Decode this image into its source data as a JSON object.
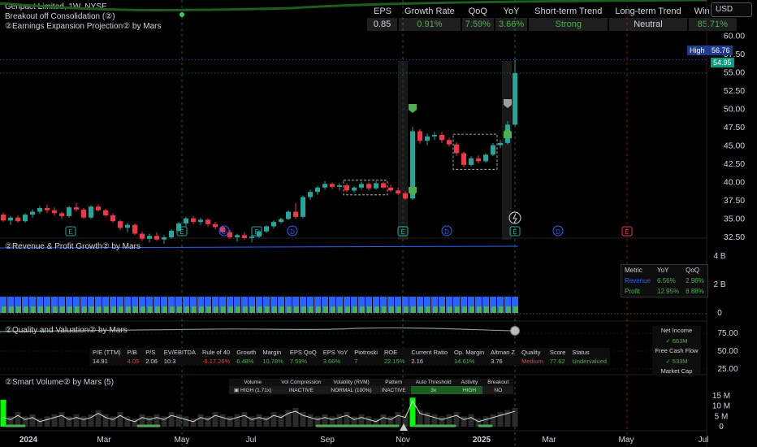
{
  "header": {
    "title": "Genpact Limited, 1W, NYSE",
    "indicator_1": "Breakout off Consolidation (②)",
    "indicator_2": "②Earnings Expansion Projection② by Mars",
    "currency_button": "USD"
  },
  "stats_table": {
    "headers": [
      "EPS",
      "Growth Rate",
      "QoQ",
      "YoY",
      "Short-term Trend",
      "Long-term Trend",
      "Win Rate"
    ],
    "values": [
      "0.85",
      "0.91%",
      "7.59%",
      "3.66%",
      "Strong",
      "Neutral",
      "85.71%"
    ]
  },
  "price_tags": {
    "high_label": "High",
    "high_value": "56.76",
    "last_value": "54.95"
  },
  "chart_data": [
    {
      "type": "candlestick",
      "title": "Genpact Limited, 1W, NYSE",
      "y_ticks": [
        "60.00",
        "57.50",
        "55.00",
        "52.50",
        "50.00",
        "47.50",
        "45.00",
        "42.50",
        "40.00",
        "37.50",
        "35.00",
        "32.50"
      ],
      "ylim": [
        31.5,
        61.5
      ],
      "x_ticks": [
        "2024",
        "Mar",
        "May",
        "Jul",
        "Sep",
        "Nov",
        "2025",
        "Mar",
        "May",
        "Jul"
      ],
      "high": 56.76,
      "last": 54.95,
      "candles": [
        [
          35.6,
          35.9,
          34.6,
          34.8
        ],
        [
          34.8,
          35.4,
          34.2,
          35.2
        ],
        [
          35.2,
          35.5,
          34.5,
          34.7
        ],
        [
          34.7,
          35.8,
          34.5,
          35.6
        ],
        [
          35.6,
          36.3,
          35.2,
          36.0
        ],
        [
          36.0,
          36.8,
          35.7,
          36.5
        ],
        [
          36.5,
          37.0,
          35.8,
          36.2
        ],
        [
          36.2,
          36.6,
          35.5,
          35.8
        ],
        [
          35.8,
          36.0,
          35.0,
          35.4
        ],
        [
          35.4,
          36.8,
          35.2,
          36.6
        ],
        [
          36.6,
          37.2,
          36.0,
          36.3
        ],
        [
          36.3,
          36.5,
          35.0,
          35.2
        ],
        [
          35.2,
          36.9,
          35.0,
          36.7
        ],
        [
          36.7,
          37.0,
          36.0,
          36.2
        ],
        [
          36.2,
          36.4,
          35.3,
          35.5
        ],
        [
          35.5,
          35.8,
          34.5,
          34.7
        ],
        [
          34.7,
          34.9,
          33.5,
          33.8
        ],
        [
          33.8,
          34.5,
          33.2,
          34.2
        ],
        [
          34.2,
          34.4,
          32.8,
          33.0
        ],
        [
          33.0,
          33.3,
          32.0,
          32.3
        ],
        [
          32.3,
          33.0,
          31.8,
          32.7
        ],
        [
          32.7,
          33.2,
          32.0,
          32.2
        ],
        [
          32.2,
          32.8,
          31.6,
          32.5
        ],
        [
          32.5,
          33.6,
          32.3,
          33.4
        ],
        [
          33.4,
          34.6,
          33.2,
          34.4
        ],
        [
          34.4,
          35.3,
          34.0,
          35.1
        ],
        [
          35.1,
          35.4,
          34.3,
          34.6
        ],
        [
          34.6,
          35.2,
          34.2,
          34.9
        ],
        [
          34.9,
          35.1,
          34.0,
          34.3
        ],
        [
          34.3,
          34.6,
          33.6,
          33.9
        ],
        [
          33.9,
          34.1,
          33.0,
          33.2
        ],
        [
          33.2,
          33.5,
          32.3,
          32.5
        ],
        [
          32.5,
          33.0,
          31.9,
          32.8
        ],
        [
          32.8,
          33.2,
          32.2,
          32.4
        ],
        [
          32.4,
          32.9,
          31.8,
          32.6
        ],
        [
          32.6,
          33.5,
          32.4,
          33.3
        ],
        [
          33.3,
          34.2,
          33.1,
          34.0
        ],
        [
          34.0,
          34.8,
          33.7,
          34.6
        ],
        [
          34.6,
          35.2,
          34.4,
          35.0
        ],
        [
          35.0,
          36.2,
          34.9,
          36.0
        ],
        [
          36.0,
          37.2,
          35.0,
          35.3
        ],
        [
          35.3,
          38.2,
          35.1,
          38.0
        ],
        [
          38.0,
          39.0,
          37.6,
          38.7
        ],
        [
          38.7,
          39.5,
          38.3,
          39.3
        ],
        [
          39.3,
          40.2,
          39.0,
          39.8
        ],
        [
          39.8,
          40.0,
          39.1,
          39.4
        ],
        [
          39.4,
          39.9,
          38.9,
          39.6
        ],
        [
          39.6,
          39.9,
          38.7,
          38.9
        ],
        [
          38.9,
          39.5,
          38.6,
          39.3
        ],
        [
          39.3,
          40.1,
          39.0,
          39.8
        ],
        [
          39.8,
          40.0,
          38.9,
          39.2
        ],
        [
          39.2,
          40.2,
          39.0,
          39.9
        ],
        [
          39.9,
          40.1,
          39.1,
          39.3
        ],
        [
          39.3,
          39.7,
          38.7,
          38.9
        ],
        [
          38.9,
          39.3,
          38.3,
          38.5
        ],
        [
          38.5,
          38.8,
          37.6,
          37.8
        ],
        [
          37.8,
          47.6,
          37.6,
          47.0
        ],
        [
          47.0,
          47.3,
          45.3,
          45.7
        ],
        [
          45.7,
          46.7,
          45.1,
          46.3
        ],
        [
          46.3,
          46.9,
          45.8,
          46.5
        ],
        [
          46.5,
          46.9,
          45.4,
          45.8
        ],
        [
          45.8,
          46.1,
          44.9,
          45.2
        ],
        [
          45.2,
          45.5,
          43.6,
          44.0
        ],
        [
          44.0,
          44.2,
          42.1,
          42.4
        ],
        [
          42.4,
          43.6,
          42.2,
          43.3
        ],
        [
          43.3,
          43.7,
          42.6,
          42.9
        ],
        [
          42.9,
          44.0,
          42.7,
          43.8
        ],
        [
          43.8,
          45.4,
          43.6,
          45.1
        ],
        [
          45.1,
          45.8,
          44.7,
          45.4
        ],
        [
          45.4,
          48.4,
          45.2,
          47.9
        ],
        [
          47.9,
          56.76,
          47.7,
          54.95
        ]
      ],
      "earnings_markers": [
        "E",
        "E",
        "D",
        "E",
        "D",
        "E",
        "D",
        "E",
        "D",
        "E"
      ]
    },
    {
      "type": "bar",
      "title": "②Revenue & Profit Growth② by Mars",
      "y_ticks": [
        "4 B",
        "2 B",
        "0"
      ],
      "table": {
        "headers": [
          "Metric",
          "YoY",
          "QoQ"
        ],
        "rows": [
          [
            "Revenue",
            "6.56%",
            "2.96%"
          ],
          [
            "Profit",
            "12.95%",
            "8.88%"
          ]
        ]
      }
    },
    {
      "type": "line",
      "title": "②Quality and Valuation② by Mars",
      "y_ticks": [
        "75.00",
        "50.00",
        "25.00"
      ],
      "table": {
        "headers": [
          "P/E (TTM)",
          "P/B",
          "P/S",
          "EV/EBITDA",
          "Rule of 40",
          "Growth",
          "Margin",
          "EPS QoQ",
          "EPS YoY",
          "Piotroski",
          "ROE",
          "Current Ratio",
          "Op. Margin",
          "Altman Z",
          "Quality",
          "Score",
          "Status"
        ],
        "values": [
          "14.91",
          "4.05",
          "2.06",
          "10.3",
          "-6.17.26%",
          "6.48%",
          "10.78%",
          "7.59%",
          "3.66%",
          "7",
          "22.15%",
          "2.16",
          "14.61%",
          "3.76",
          "Medium",
          "77.62",
          "Undervalued"
        ]
      },
      "side_panel": {
        "net_income_label": "Net Income",
        "net_income_value": "✓ 663M",
        "free_cash_flow_label": "Free Cash Flow",
        "free_cash_flow_value": "✓ 533M",
        "market_cap_label": "Market Cap"
      }
    },
    {
      "type": "bar",
      "title": "②Smart Volume② by Mars (5)",
      "y_ticks": [
        "15 M",
        "10 M",
        "5 M",
        "0"
      ],
      "table": {
        "headers": [
          "Volume",
          "Vol Compression",
          "Volatility (RVM)",
          "Pattern",
          "Auto Threshold",
          "Activity",
          "Breakout"
        ],
        "values": [
          "▣ HIGH (1.71x)",
          "INACTIVE",
          "NORMAL (100%)",
          "INACTIVE",
          "3x",
          "HIGH",
          "NO"
        ]
      },
      "volumes": [
        6,
        5,
        7,
        5,
        6,
        4,
        5,
        6,
        7,
        5,
        6,
        5,
        6,
        8,
        6,
        5,
        7,
        5,
        4,
        6,
        5,
        6,
        5,
        7,
        6,
        5,
        4,
        6,
        5,
        7,
        6,
        5,
        6,
        7,
        5,
        6,
        5,
        7,
        6,
        8,
        9,
        7,
        6,
        5,
        6,
        5,
        6,
        7,
        5,
        6,
        5,
        4,
        6,
        5,
        7,
        6,
        14,
        8,
        7,
        6,
        5,
        6,
        7,
        5,
        6,
        4,
        5,
        6,
        7,
        8,
        9
      ]
    }
  ],
  "colors": {
    "up": "#26a69a",
    "down": "#f23645",
    "accent_green": "#00ff00",
    "revenue": "#2962ff",
    "profit": "#4caf50",
    "earnings_marker": "#26a69a",
    "dividend_marker": "#2962ff",
    "exp_marker": "#f23645"
  }
}
